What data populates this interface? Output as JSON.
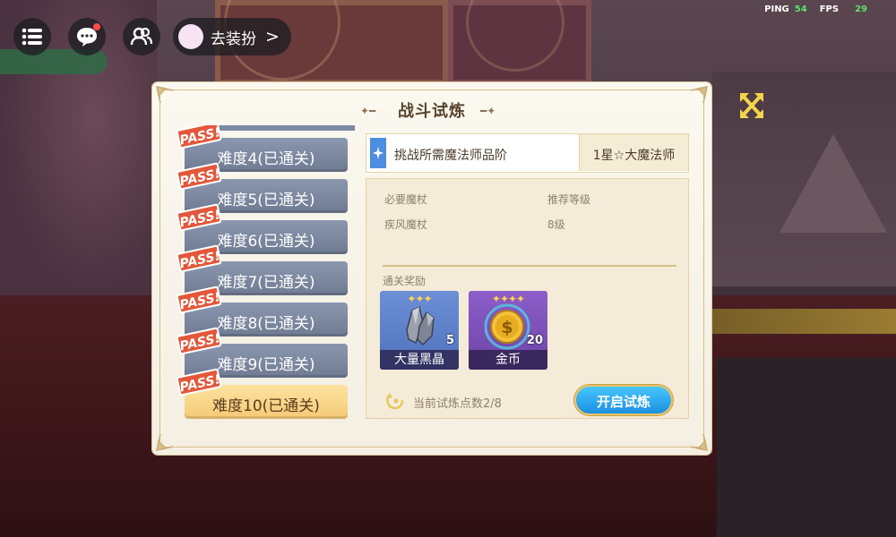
{
  "hud": {
    "dress_up_label": "去装扮",
    "dress_up_arrow": ">",
    "ping_label": "PING",
    "ping_value": "54",
    "fps_label": "FPS",
    "fps_value": "29"
  },
  "dialog": {
    "title": "战斗试炼",
    "pass_badge": "PASS!",
    "difficulties": [
      {
        "label": "难度4(已通关)"
      },
      {
        "label": "难度5(已通关)"
      },
      {
        "label": "难度6(已通关)"
      },
      {
        "label": "难度7(已通关)"
      },
      {
        "label": "难度8(已通关)"
      },
      {
        "label": "难度9(已通关)"
      },
      {
        "label": "难度10(已通关)"
      }
    ],
    "selected_index": 6,
    "requirement": {
      "label": "挑战所需魔法师品阶",
      "value": "1星☆大魔法师"
    },
    "info": {
      "required_wand_label": "必要魔杖",
      "required_wand_value": "疾风魔杖",
      "recommended_level_label": "推荐等级",
      "recommended_level_value": "8级"
    },
    "rewards_title": "通关奖励",
    "rewards": [
      {
        "name": "大量黑晶",
        "count": "5",
        "stars": "✦✦✦"
      },
      {
        "name": "金币",
        "count": "20",
        "stars": "✦✦✦✦"
      }
    ],
    "trial_points": "当前试炼点数2/8",
    "start_button": "开启试炼"
  },
  "colors": {
    "accent_blue": "#1b8fe0",
    "pass_red": "#e4573a",
    "active_tab": "#f4c976",
    "inactive_tab": "#6f7b93"
  }
}
